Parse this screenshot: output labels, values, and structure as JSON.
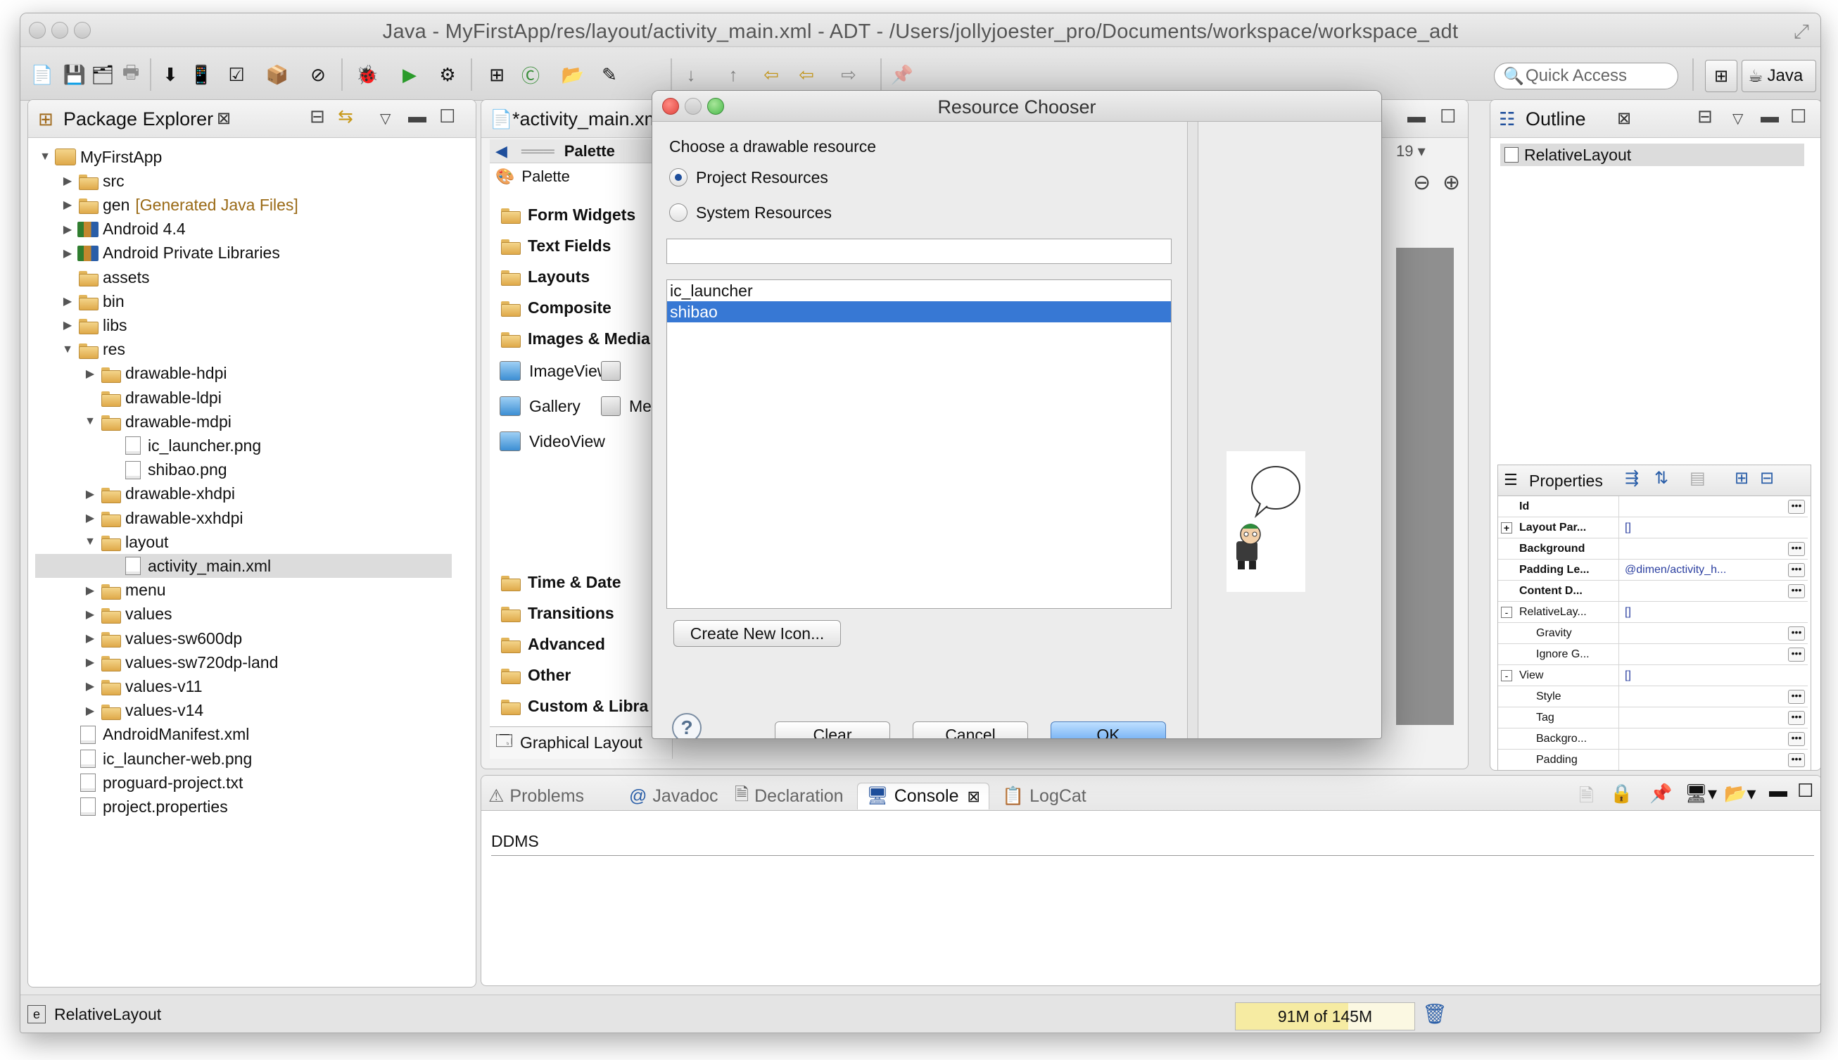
{
  "window": {
    "title": "Java - MyFirstApp/res/layout/activity_main.xml - ADT - /Users/jollyjoester_pro/Documents/workspace/workspace_adt"
  },
  "toolbar": {
    "quick_access_placeholder": "Quick Access",
    "perspective_label": "Java",
    "icons": [
      "new-icon",
      "save-icon",
      "save-all-icon",
      "print-icon",
      "sdk-manager-icon",
      "avd-manager-icon",
      "lint-icon",
      "android-project-icon",
      "skip-breakpoints-icon",
      "debug-icon",
      "run-icon",
      "external-tools-icon",
      "new-java-package-icon",
      "new-java-class-icon",
      "open-type-icon",
      "search-icon",
      "annotation-next-icon",
      "annotation-prev-icon",
      "back-icon",
      "forward-icon",
      "pin-editor-icon"
    ]
  },
  "package_explorer": {
    "title": "Package Explorer",
    "tree": [
      {
        "label": "MyFirstApp",
        "depth": 0,
        "twisty": "open",
        "icon": "project-icon"
      },
      {
        "label": "src",
        "depth": 1,
        "twisty": "closed",
        "icon": "folder-icon"
      },
      {
        "label": "gen",
        "note": "[Generated Java Files]",
        "depth": 1,
        "twisty": "closed",
        "icon": "folder-icon"
      },
      {
        "label": "Android 4.4",
        "depth": 1,
        "twisty": "closed",
        "icon": "lib-icon"
      },
      {
        "label": "Android Private Libraries",
        "depth": 1,
        "twisty": "closed",
        "icon": "lib-icon"
      },
      {
        "label": "assets",
        "depth": 1,
        "twisty": "none",
        "icon": "folder-icon"
      },
      {
        "label": "bin",
        "depth": 1,
        "twisty": "closed",
        "icon": "folder-icon"
      },
      {
        "label": "libs",
        "depth": 1,
        "twisty": "closed",
        "icon": "folder-icon"
      },
      {
        "label": "res",
        "depth": 1,
        "twisty": "open",
        "icon": "folder-icon"
      },
      {
        "label": "drawable-hdpi",
        "depth": 2,
        "twisty": "closed",
        "icon": "folder-icon"
      },
      {
        "label": "drawable-ldpi",
        "depth": 2,
        "twisty": "none",
        "icon": "folder-icon"
      },
      {
        "label": "drawable-mdpi",
        "depth": 2,
        "twisty": "open",
        "icon": "folder-icon"
      },
      {
        "label": "ic_launcher.png",
        "depth": 3,
        "twisty": "none",
        "icon": "file-icon"
      },
      {
        "label": "shibao.png",
        "depth": 3,
        "twisty": "none",
        "icon": "file-icon"
      },
      {
        "label": "drawable-xhdpi",
        "depth": 2,
        "twisty": "closed",
        "icon": "folder-icon"
      },
      {
        "label": "drawable-xxhdpi",
        "depth": 2,
        "twisty": "closed",
        "icon": "folder-icon"
      },
      {
        "label": "layout",
        "depth": 2,
        "twisty": "open",
        "icon": "folder-icon"
      },
      {
        "label": "activity_main.xml",
        "depth": 3,
        "twisty": "none",
        "icon": "file-icon",
        "selected": true
      },
      {
        "label": "menu",
        "depth": 2,
        "twisty": "closed",
        "icon": "folder-icon"
      },
      {
        "label": "values",
        "depth": 2,
        "twisty": "closed",
        "icon": "folder-icon"
      },
      {
        "label": "values-sw600dp",
        "depth": 2,
        "twisty": "closed",
        "icon": "folder-icon"
      },
      {
        "label": "values-sw720dp-land",
        "depth": 2,
        "twisty": "closed",
        "icon": "folder-icon"
      },
      {
        "label": "values-v11",
        "depth": 2,
        "twisty": "closed",
        "icon": "folder-icon"
      },
      {
        "label": "values-v14",
        "depth": 2,
        "twisty": "closed",
        "icon": "folder-icon"
      },
      {
        "label": "AndroidManifest.xml",
        "depth": 1,
        "twisty": "none",
        "icon": "file-icon"
      },
      {
        "label": "ic_launcher-web.png",
        "depth": 1,
        "twisty": "none",
        "icon": "file-icon"
      },
      {
        "label": "proguard-project.txt",
        "depth": 1,
        "twisty": "none",
        "icon": "file-icon"
      },
      {
        "label": "project.properties",
        "depth": 1,
        "twisty": "none",
        "icon": "file-icon"
      }
    ]
  },
  "editor": {
    "tab_label": "*activity_main.xml",
    "palette_header": "Palette",
    "palette_title": "Palette",
    "api_level": "19",
    "categories_top": [
      "Form Widgets",
      "Text Fields",
      "Layouts",
      "Composite",
      "Images & Media"
    ],
    "media_items": [
      {
        "left": "ImageView",
        "right": ""
      },
      {
        "left": "Gallery",
        "right": "Med"
      },
      {
        "left": "VideoView",
        "right": ""
      }
    ],
    "categories_bottom": [
      "Time & Date",
      "Transitions",
      "Advanced",
      "Other",
      "Custom & Libra"
    ],
    "bottom_tab": "Graphical Layout"
  },
  "outline": {
    "title": "Outline",
    "items": [
      "RelativeLayout"
    ]
  },
  "properties": {
    "title": "Properties",
    "rows": [
      {
        "name": "Id",
        "value": "",
        "bold": true,
        "dots": true,
        "indent": 0,
        "toggle": ""
      },
      {
        "name": "Layout Par...",
        "value": "[]",
        "bold": true,
        "dots": false,
        "indent": 0,
        "toggle": "+"
      },
      {
        "name": "Background",
        "value": "",
        "bold": true,
        "dots": true,
        "indent": 0,
        "toggle": ""
      },
      {
        "name": "Padding Le...",
        "value": "@dimen/activity_h...",
        "bold": true,
        "dots": true,
        "indent": 0,
        "toggle": ""
      },
      {
        "name": "Content D...",
        "value": "",
        "bold": true,
        "dots": true,
        "indent": 0,
        "toggle": ""
      },
      {
        "name": "RelativeLay...",
        "value": "[]",
        "bold": false,
        "dots": false,
        "indent": 0,
        "toggle": "-"
      },
      {
        "name": "Gravity",
        "value": "",
        "bold": false,
        "dots": true,
        "indent": 1,
        "toggle": ""
      },
      {
        "name": "Ignore G...",
        "value": "",
        "bold": false,
        "dots": true,
        "indent": 1,
        "toggle": ""
      },
      {
        "name": "View",
        "value": "[]",
        "bold": false,
        "dots": false,
        "indent": 0,
        "toggle": "-"
      },
      {
        "name": "Style",
        "value": "",
        "bold": false,
        "dots": true,
        "indent": 1,
        "toggle": ""
      },
      {
        "name": "Tag",
        "value": "",
        "bold": false,
        "dots": true,
        "indent": 1,
        "toggle": ""
      },
      {
        "name": "Backgro...",
        "value": "",
        "bold": false,
        "dots": true,
        "indent": 1,
        "toggle": ""
      },
      {
        "name": "Padding",
        "value": "",
        "bold": false,
        "dots": true,
        "indent": 1,
        "toggle": ""
      }
    ]
  },
  "console": {
    "tabs": [
      "Problems",
      "Javadoc",
      "Declaration",
      "Console",
      "LogCat"
    ],
    "active_tab": "Console",
    "content_title": "DDMS"
  },
  "statusbar": {
    "selection": "RelativeLayout",
    "heap": "91M of 145M",
    "heap_used_fraction": 0.63
  },
  "dialog": {
    "title": "Resource Chooser",
    "prompt": "Choose a drawable resource",
    "radio_project": "Project Resources",
    "radio_system": "System Resources",
    "selected_source": "project",
    "filter_value": "",
    "resources": [
      "ic_launcher",
      "shibao"
    ],
    "selected_resource": "shibao",
    "create_icon_label": "Create New Icon...",
    "clear_label": "Clear",
    "cancel_label": "Cancel",
    "ok_label": "OK"
  },
  "colors": {
    "selection_blue": "#3778d4",
    "dialog_close_red": "#e0443e",
    "dialog_max_green": "#49b94a"
  }
}
